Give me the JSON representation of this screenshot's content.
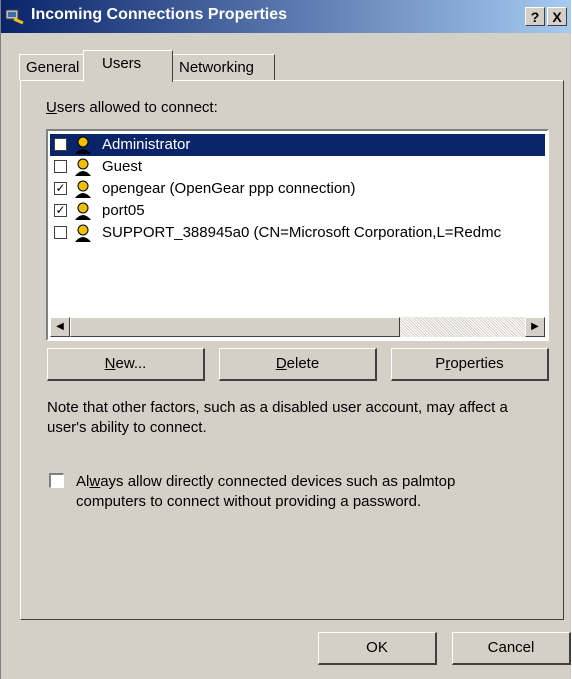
{
  "window": {
    "title": "Incoming Connections Properties",
    "help_label": "?",
    "close_label": "X"
  },
  "tabs": [
    {
      "label": "General"
    },
    {
      "label": "Users"
    },
    {
      "label": "Networking"
    }
  ],
  "users_label_u": "U",
  "users_label_rest": "sers allowed to connect:",
  "users": [
    {
      "name": "Administrator",
      "checked": false,
      "selected": true
    },
    {
      "name": "Guest",
      "checked": false,
      "selected": false
    },
    {
      "name": "opengear (OpenGear ppp connection)",
      "checked": true,
      "selected": false
    },
    {
      "name": "port05",
      "checked": true,
      "selected": false
    },
    {
      "name": "SUPPORT_388945a0 (CN=Microsoft Corporation,L=Redmc",
      "checked": false,
      "selected": false
    }
  ],
  "buttons": {
    "new_u": "N",
    "new_rest": "ew...",
    "delete_u": "D",
    "delete_rest": "elete",
    "props_pre": "P",
    "props_u": "r",
    "props_rest": "operties"
  },
  "note": "Note that other factors, such as a disabled user account, may affect a user's ability to connect.",
  "always_allow": {
    "pre": "Al",
    "u": "w",
    "rest": "ays allow directly connected devices such as palmtop computers to connect without providing a password.",
    "checked": false
  },
  "dialog": {
    "ok_label": "OK",
    "cancel_label": "Cancel"
  },
  "check_glyph": "✓"
}
